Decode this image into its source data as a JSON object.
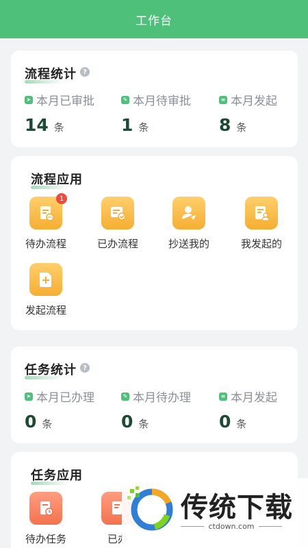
{
  "header": {
    "title": "工作台"
  },
  "process_stats": {
    "title": "流程统计",
    "items": [
      {
        "label": "本月已审批",
        "value": "14",
        "unit": "条"
      },
      {
        "label": "本月待审批",
        "value": "1",
        "unit": "条"
      },
      {
        "label": "本月发起",
        "value": "8",
        "unit": "条"
      }
    ]
  },
  "process_apps": {
    "title": "流程应用",
    "items": [
      {
        "label": "待办流程",
        "badge": "1",
        "icon": "pending-doc-icon"
      },
      {
        "label": "已办流程",
        "icon": "done-doc-icon"
      },
      {
        "label": "抄送我的",
        "icon": "cc-user-icon"
      },
      {
        "label": "我发起的",
        "icon": "initiated-doc-icon"
      },
      {
        "label": "发起流程",
        "icon": "new-doc-icon"
      }
    ]
  },
  "task_stats": {
    "title": "任务统计",
    "items": [
      {
        "label": "本月已办理",
        "value": "0",
        "unit": "条"
      },
      {
        "label": "本月待办理",
        "value": "0",
        "unit": "条"
      },
      {
        "label": "本月发起",
        "value": "0",
        "unit": "条"
      }
    ]
  },
  "task_apps": {
    "title": "任务应用",
    "items": [
      {
        "label": "待办任务",
        "icon": "pending-task-icon"
      },
      {
        "label": "已办",
        "icon": "done-task-icon"
      }
    ]
  },
  "watermark": {
    "brand": "传统下载",
    "url": "ctdown.com"
  },
  "colors": {
    "accent": "#4fc07a",
    "dark_value": "#1d4a33",
    "badge": "#f04a3c",
    "app_yellow": "#f6ae32",
    "app_orange": "#f3724e"
  }
}
